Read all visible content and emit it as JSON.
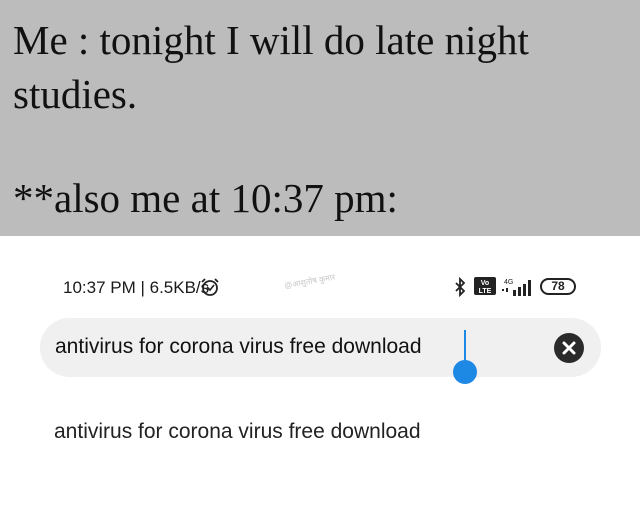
{
  "caption": {
    "line1": "Me : tonight I will do late night",
    "line2": "studies.",
    "line3": "**also me at 10:37 pm:"
  },
  "statusbar": {
    "time_speed": "10:37 PM | 6.5KB/s",
    "watermark": "@आशुतोष कुमार",
    "battery": "78",
    "volte": "Vo LTE",
    "network": "4G",
    "icons": [
      "alarm-icon",
      "bluetooth-icon",
      "volte-icon",
      "signal-icon",
      "battery-icon"
    ]
  },
  "search": {
    "query": "antivirus for corona virus free download",
    "accent_color": "#1e88e5"
  },
  "suggestions": [
    "antivirus for corona virus free download"
  ],
  "colors": {
    "caption_bg": "#bcbcbc",
    "search_bg": "#f0f0f0"
  }
}
